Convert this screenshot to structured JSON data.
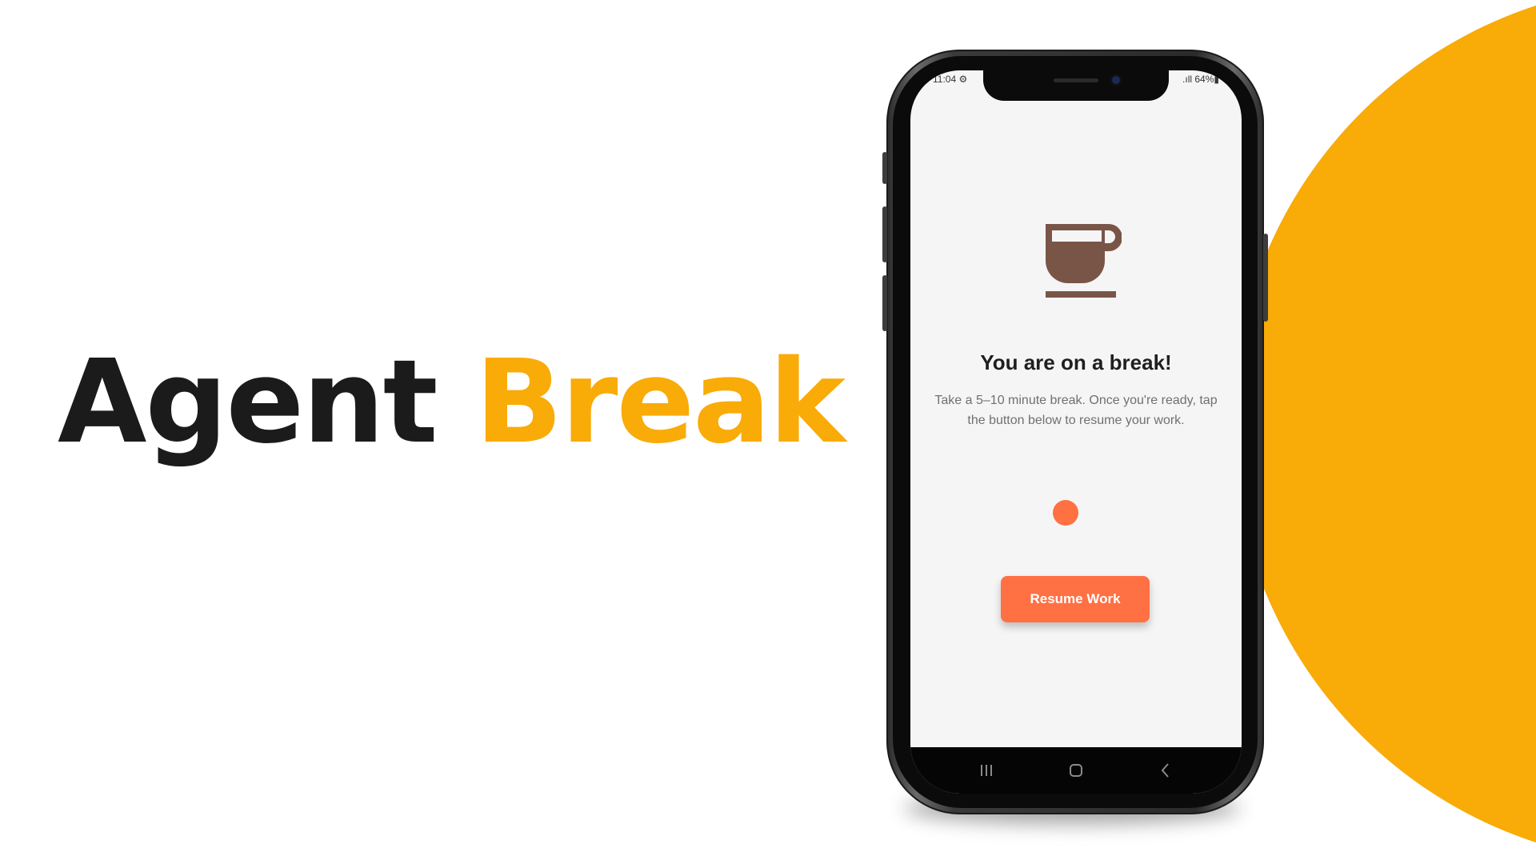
{
  "headline": {
    "word1": "Agent",
    "word2": "Break"
  },
  "colors": {
    "accent_yellow": "#f9ab07",
    "button_orange": "#ff7043",
    "cup_brown": "#795548",
    "headline_dark": "#1b1b1b"
  },
  "phone": {
    "status_bar": {
      "time": "11:04 ⚙",
      "right": ".ıll 64%▮"
    },
    "screen": {
      "icon": "coffee-cup-icon",
      "title": "You are on a break!",
      "description": "Take a 5–10 minute break. Once you're ready, tap the button below to resume your work.",
      "button_label": "Resume Work"
    },
    "nav_bar": {
      "items": [
        "recent-apps-icon",
        "home-icon",
        "back-icon"
      ]
    }
  }
}
